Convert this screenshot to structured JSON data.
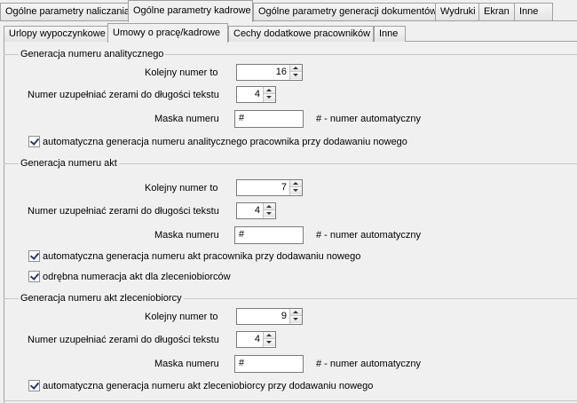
{
  "tabs_top": [
    {
      "label": "Ogólne parametry naliczania"
    },
    {
      "label": "Ogólne parametry kadrowe"
    },
    {
      "label": "Ogólne parametry generacji dokumentów"
    },
    {
      "label": "Wydruki"
    },
    {
      "label": "Ekran"
    },
    {
      "label": "Inne"
    }
  ],
  "tabs_sub": [
    {
      "label": "Urlopy wypoczynkowe"
    },
    {
      "label": "Umowy o pracę/kadrowe"
    },
    {
      "label": "Cechy dodatkowe pracowników"
    },
    {
      "label": "Inne"
    }
  ],
  "groups": [
    {
      "title": "Generacja numeru analitycznego",
      "next_label": "Kolejny numer to",
      "next_value": "16",
      "pad_label": "Numer uzupełniać zerami do długości tekstu",
      "pad_value": "4",
      "mask_label": "Maska numeru",
      "mask_value": "#",
      "mask_hint": "# - numer automatyczny",
      "checks": [
        {
          "label": "automatyczna generacja numeru analitycznego pracownika przy dodawaniu nowego",
          "checked": true
        }
      ]
    },
    {
      "title": "Generacja numeru akt",
      "next_label": "Kolejny numer to",
      "next_value": "7",
      "pad_label": "Numer uzupełniać zerami do długości tekstu",
      "pad_value": "4",
      "mask_label": "Maska numeru",
      "mask_value": "#",
      "mask_hint": "# - numer automatyczny",
      "checks": [
        {
          "label": "automatyczna generacja numeru akt pracownika przy dodawaniu nowego",
          "checked": true
        },
        {
          "label": "odrębna numeracja akt dla zleceniobiorców",
          "checked": true
        }
      ]
    },
    {
      "title": "Generacja numeru akt zleceniobiorcy",
      "next_label": "Kolejny numer to",
      "next_value": "9",
      "pad_label": "Numer uzupełniać zerami do długości tekstu",
      "pad_value": "4",
      "mask_label": "Maska numeru",
      "mask_value": "#",
      "mask_hint": "# - numer automatyczny",
      "checks": [
        {
          "label": "automatyczna generacja numeru akt zleceniobiorcy przy dodawaniu nowego",
          "checked": true
        }
      ]
    }
  ]
}
